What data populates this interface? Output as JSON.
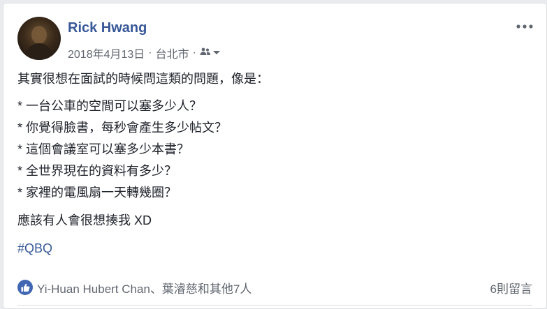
{
  "post": {
    "author": "Rick Hwang",
    "date": "2018年4月13日",
    "separator1": "·",
    "location": "台北市",
    "separator2": "·",
    "intro": "其實很想在面試的時候問這類的問題，像是：",
    "questions": [
      "* 一台公車的空間可以塞多少人？",
      "* 你覺得臉書，每秒會產生多少帖文？",
      "* 這個會議室可以塞多少本書？",
      "* 全世界現在的資料有多少？",
      "* 家裡的電風扇一天轉幾圈？"
    ],
    "closing": "應該有人會很想揍我 XD",
    "hashtag": "#QBQ"
  },
  "footer": {
    "reactions_text": "Yi-Huan Hubert Chan、葉濬慈和其他7人",
    "comments_text": "6則留言"
  },
  "icons": {
    "more": "more-options-icon",
    "audience": "friends-icon",
    "dropdown": "chevron-down-icon",
    "like": "like-icon"
  },
  "colors": {
    "link": "#385898",
    "meta": "#616770",
    "like_badge": "#4267b2"
  }
}
